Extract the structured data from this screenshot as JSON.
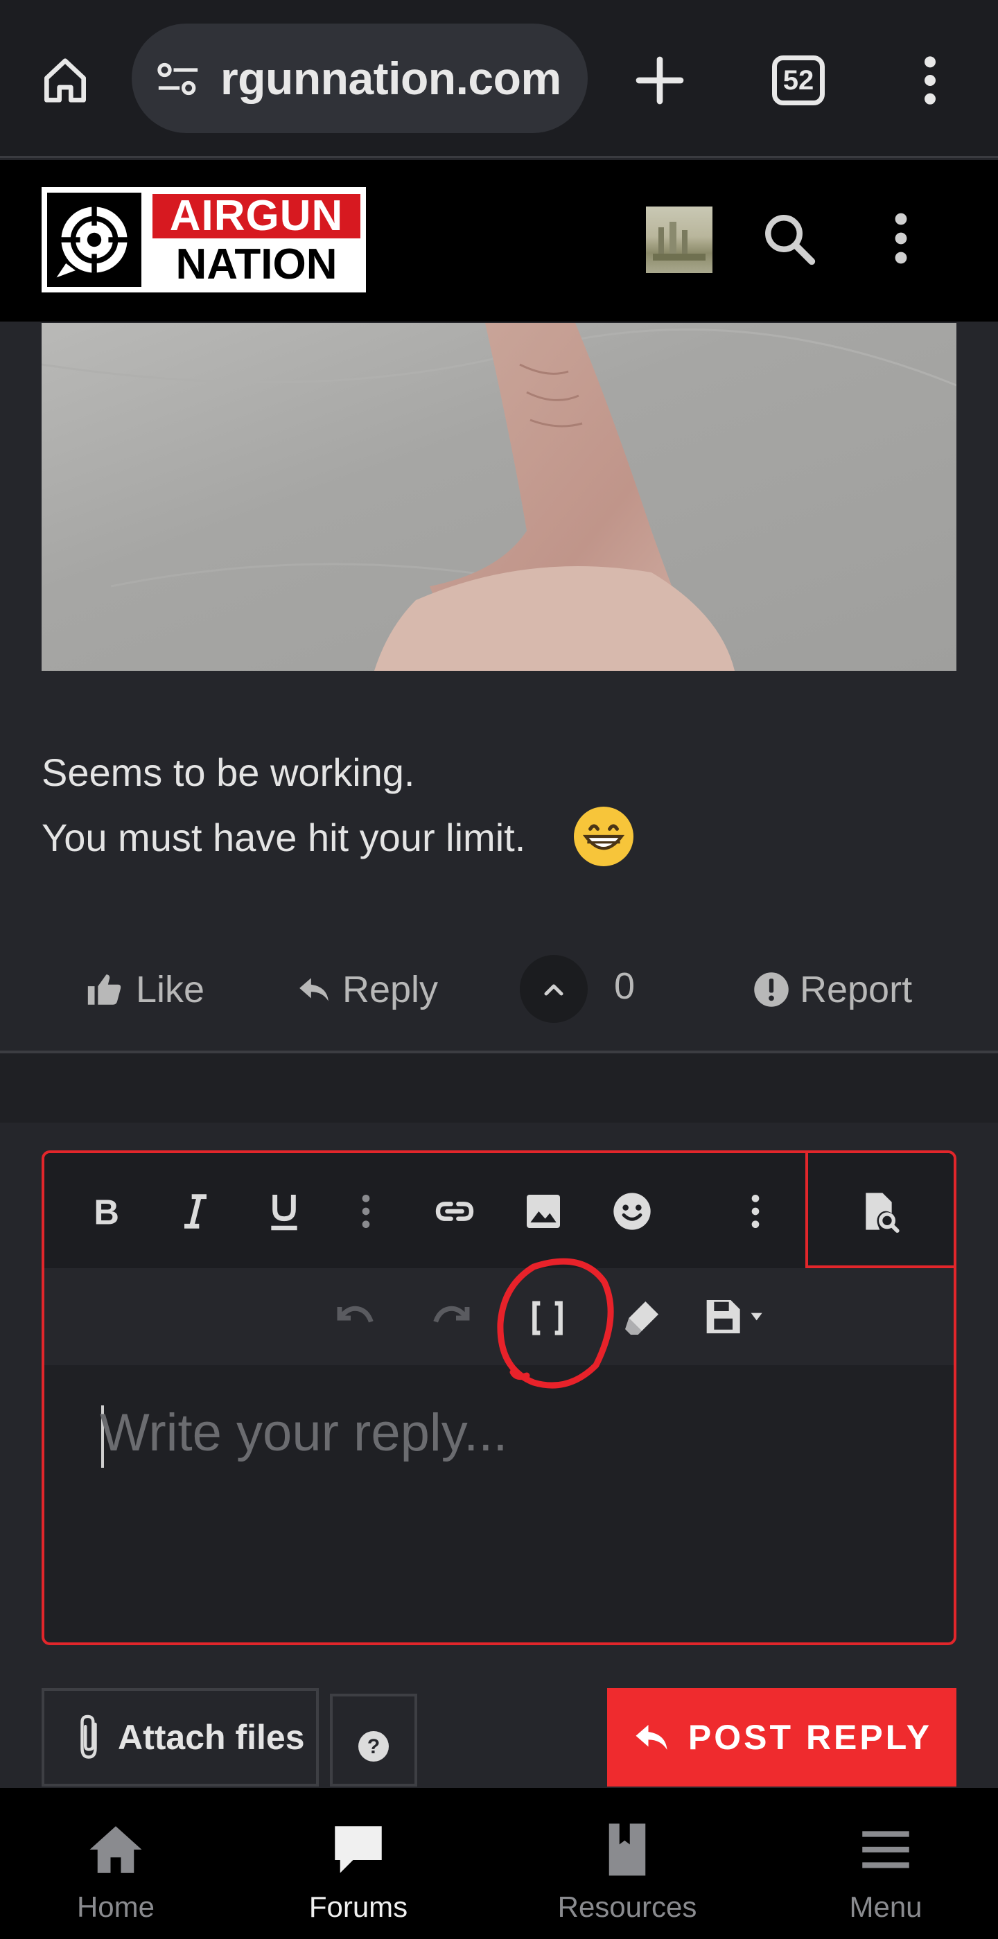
{
  "browser": {
    "url": "rgunnation.com",
    "tab_count": "52",
    "icons": [
      "home-icon",
      "site-settings-icon",
      "plus-icon",
      "tab-switcher-icon",
      "overflow-menu-icon"
    ]
  },
  "site": {
    "logo_line1": "AIRGUN",
    "logo_line2": "NATION",
    "brand_color": "#d71920"
  },
  "post": {
    "line1": "Seems to be working.",
    "line2": "You must have hit your limit.",
    "emoji": "grinning-face",
    "actions": {
      "like": "Like",
      "reply": "Reply",
      "vote_count": "0",
      "report": "Report"
    }
  },
  "editor": {
    "placeholder": "Write your reply...",
    "toolbar1": [
      "bold-icon",
      "italic-icon",
      "underline-icon",
      "more-text-icon",
      "link-icon",
      "image-icon",
      "emoji-icon",
      "more-insert-icon",
      "preview-icon"
    ],
    "toolbar2": [
      "undo-icon",
      "redo-icon",
      "bbcode-toggle-icon",
      "clear-format-icon",
      "drafts-icon"
    ],
    "accent_color": "#e2262b"
  },
  "buttons": {
    "attach_files": "Attach files",
    "post_reply": "POST REPLY"
  },
  "bottom_nav": {
    "items": [
      {
        "label": "Home",
        "icon": "home-icon"
      },
      {
        "label": "Forums",
        "icon": "forums-icon",
        "active": true
      },
      {
        "label": "Resources",
        "icon": "resources-icon"
      },
      {
        "label": "Menu",
        "icon": "menu-icon"
      }
    ]
  }
}
